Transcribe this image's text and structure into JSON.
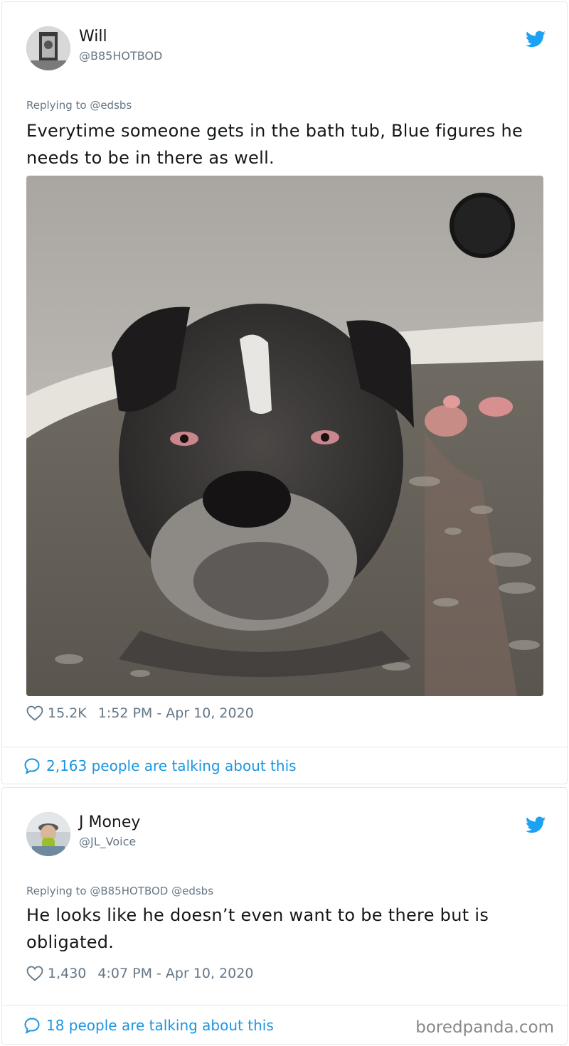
{
  "tweets": [
    {
      "name": "Will",
      "handle": "@B85HOTBOD",
      "replying_to": "Replying to @edsbs",
      "text": "Everytime someone gets in the bath tub, Blue figures he needs to be in there as well.",
      "likes": "15.2K",
      "timestamp": "1:52 PM - Apr 10, 2020",
      "talking": "2,163 people are talking about this"
    },
    {
      "name": "J Money",
      "handle": "@JL_Voice",
      "replying_to": "Replying to @B85HOTBOD @edsbs",
      "text": "He looks like he doesn’t even want to be there but is obligated.",
      "likes": "1,430",
      "timestamp": "4:07 PM - Apr 10, 2020",
      "talking": "18 people are talking about this"
    }
  ],
  "watermark": "boredpanda.com",
  "colors": {
    "link": "#1b95e0",
    "muted": "#657786",
    "twitter_blue": "#1da1f2",
    "border": "#e1e8ed"
  },
  "icons": [
    "twitter-bird-icon",
    "heart-icon",
    "speech-bubble-icon"
  ]
}
